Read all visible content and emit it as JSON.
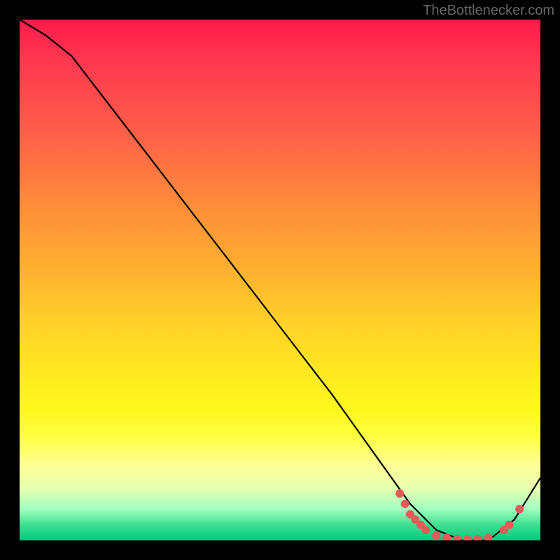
{
  "watermark": "TheBottlenecker.com",
  "chart_data": {
    "type": "line",
    "title": "",
    "xlabel": "",
    "ylabel": "",
    "xlim": [
      0,
      100
    ],
    "ylim": [
      0,
      100
    ],
    "series": [
      {
        "name": "bottleneck-curve",
        "x": [
          0,
          5,
          10,
          20,
          30,
          40,
          50,
          60,
          70,
          75,
          80,
          85,
          90,
          95,
          100
        ],
        "y": [
          100,
          97,
          93,
          80,
          67,
          54,
          41,
          28,
          14,
          7,
          2,
          0,
          0,
          4,
          12
        ]
      }
    ],
    "highlight_points": {
      "name": "optimal-range-markers",
      "color": "#e85a5a",
      "points": [
        {
          "x": 73,
          "y": 9
        },
        {
          "x": 74,
          "y": 7
        },
        {
          "x": 75,
          "y": 5
        },
        {
          "x": 76,
          "y": 4
        },
        {
          "x": 77,
          "y": 3
        },
        {
          "x": 78,
          "y": 2
        },
        {
          "x": 80,
          "y": 1
        },
        {
          "x": 82,
          "y": 0.5
        },
        {
          "x": 84,
          "y": 0.3
        },
        {
          "x": 86,
          "y": 0.2
        },
        {
          "x": 88,
          "y": 0.3
        },
        {
          "x": 90,
          "y": 0.5
        },
        {
          "x": 93,
          "y": 2
        },
        {
          "x": 94,
          "y": 3
        },
        {
          "x": 96,
          "y": 6
        }
      ]
    },
    "background": {
      "type": "vertical-gradient",
      "stops": [
        {
          "pos": 0,
          "color": "#ff1a4a"
        },
        {
          "pos": 50,
          "color": "#ffd028"
        },
        {
          "pos": 80,
          "color": "#ffff40"
        },
        {
          "pos": 100,
          "color": "#00c880"
        }
      ]
    }
  }
}
